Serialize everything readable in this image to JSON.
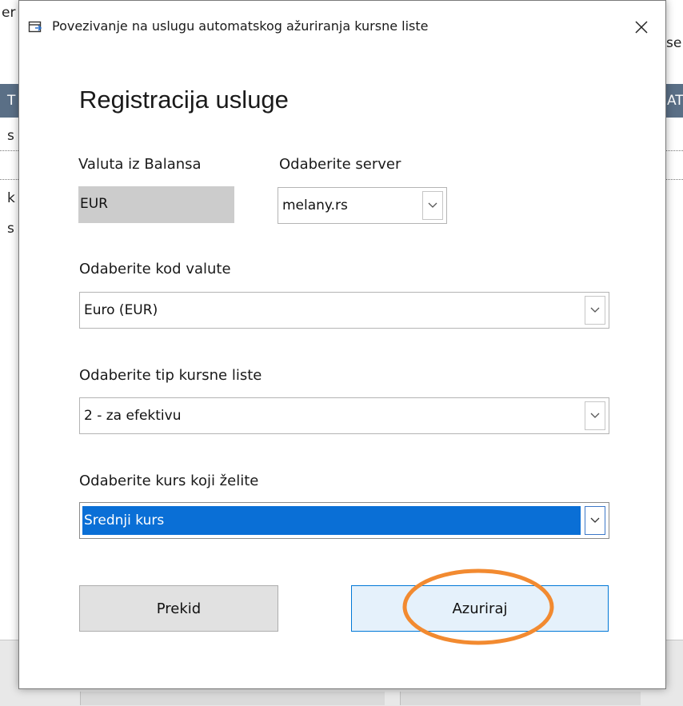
{
  "background": {
    "fragments": [
      "er",
      "se",
      "T",
      "AT",
      "s",
      "k",
      "s"
    ]
  },
  "dialog": {
    "title": "Povezivanje na uslugu automatskog ažuriranja kursne liste",
    "close_glyph": "✕",
    "heading": "Registracija usluge",
    "currency_label": "Valuta iz Balansa",
    "currency_value": "EUR",
    "server_label": "Odaberite server",
    "server_value": "melany.rs",
    "currency_code_label": "Odaberite kod valute",
    "currency_code_value": "Euro (EUR)",
    "list_type_label": "Odaberite tip kursne liste",
    "list_type_value": "2 - za efektivu",
    "rate_label": "Odaberite kurs koji želite",
    "rate_value": "Srednji kurs",
    "cancel_label": "Prekid",
    "update_label": "Azuriraj"
  },
  "colors": {
    "selection": "#0a6fd6",
    "primary_border": "#0078d7",
    "annotation": "#f28a30"
  }
}
